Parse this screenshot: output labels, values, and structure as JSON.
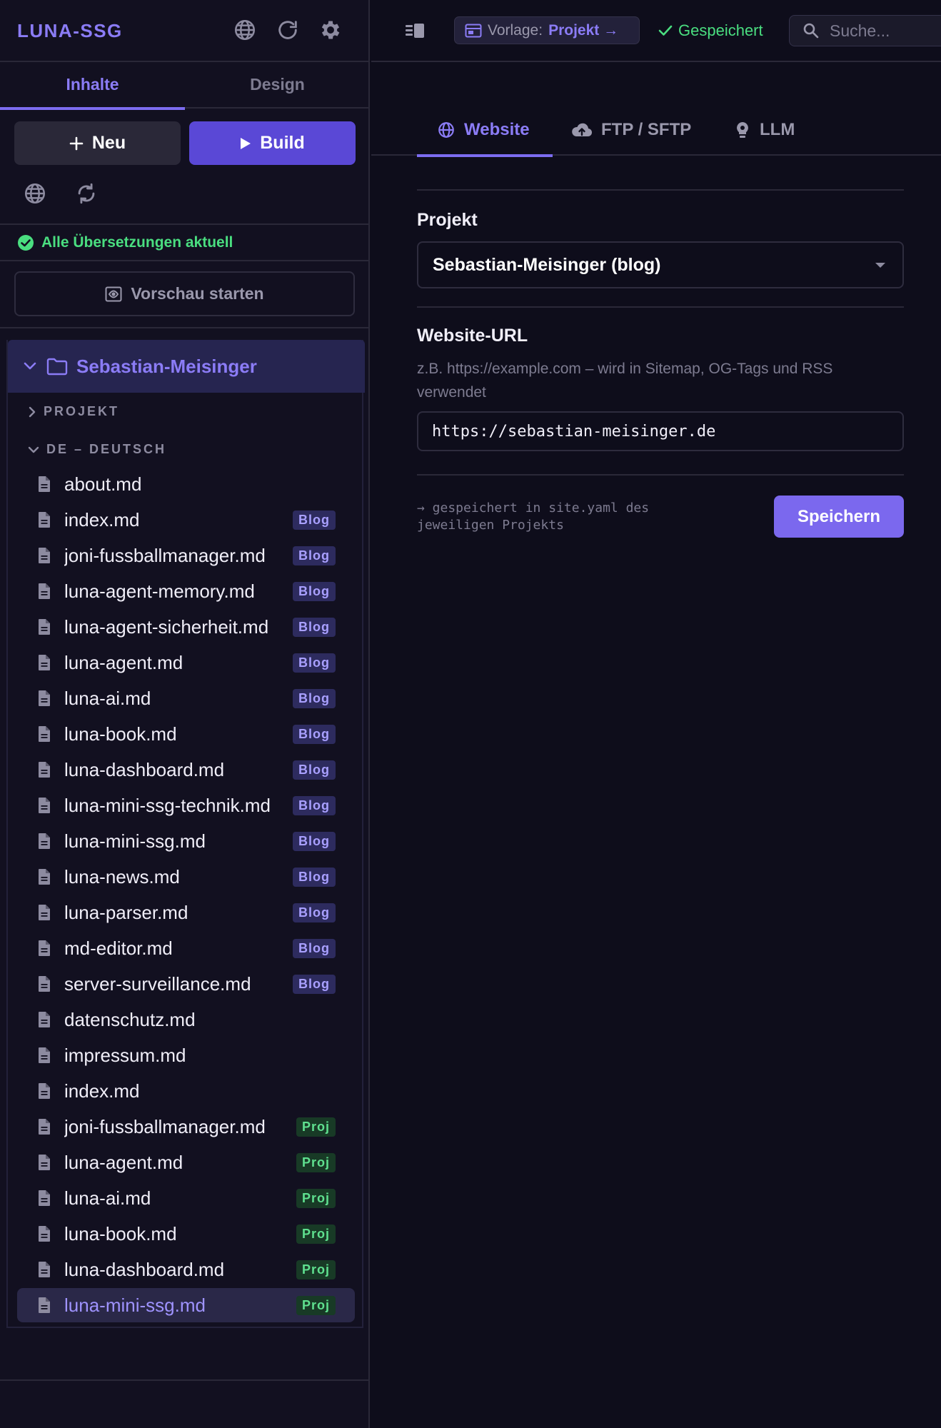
{
  "app": {
    "brand": "LUNA-SSG"
  },
  "sidebar": {
    "tabs": [
      {
        "label": "Inhalte",
        "active": true
      },
      {
        "label": "Design",
        "active": false
      }
    ],
    "new_label": "Neu",
    "build_label": "Build",
    "translation_status": "Alle Übersetzungen aktuell",
    "preview_label": "Vorschau starten",
    "tree": {
      "root": "Sebastian-Meisinger",
      "sections": [
        {
          "label": "PROJEKT",
          "expanded": false
        },
        {
          "label": "DE – DEUTSCH",
          "expanded": true
        }
      ],
      "files": [
        {
          "name": "about.md",
          "badge": ""
        },
        {
          "name": "index.md",
          "badge": "Blog"
        },
        {
          "name": "joni-fussballmanager.md",
          "badge": "Blog"
        },
        {
          "name": "luna-agent-memory.md",
          "badge": "Blog"
        },
        {
          "name": "luna-agent-sicherheit.md",
          "badge": "Blog"
        },
        {
          "name": "luna-agent.md",
          "badge": "Blog"
        },
        {
          "name": "luna-ai.md",
          "badge": "Blog"
        },
        {
          "name": "luna-book.md",
          "badge": "Blog"
        },
        {
          "name": "luna-dashboard.md",
          "badge": "Blog"
        },
        {
          "name": "luna-mini-ssg-technik.md",
          "badge": "Blog"
        },
        {
          "name": "luna-mini-ssg.md",
          "badge": "Blog"
        },
        {
          "name": "luna-news.md",
          "badge": "Blog"
        },
        {
          "name": "luna-parser.md",
          "badge": "Blog"
        },
        {
          "name": "md-editor.md",
          "badge": "Blog"
        },
        {
          "name": "server-surveillance.md",
          "badge": "Blog"
        },
        {
          "name": "datenschutz.md",
          "badge": ""
        },
        {
          "name": "impressum.md",
          "badge": ""
        },
        {
          "name": "index.md",
          "badge": ""
        },
        {
          "name": "joni-fussballmanager.md",
          "badge": "Proj"
        },
        {
          "name": "luna-agent.md",
          "badge": "Proj"
        },
        {
          "name": "luna-ai.md",
          "badge": "Proj"
        },
        {
          "name": "luna-book.md",
          "badge": "Proj"
        },
        {
          "name": "luna-dashboard.md",
          "badge": "Proj"
        },
        {
          "name": "luna-mini-ssg.md",
          "badge": "Proj",
          "selected": true
        }
      ]
    }
  },
  "topbar": {
    "template_label": "Vorlage:",
    "template_value": "Projekt →",
    "saved_label": "Gespeichert",
    "search_placeholder": "Suche..."
  },
  "main": {
    "tabs": [
      {
        "label": "Website",
        "icon": "globe-icon",
        "active": true
      },
      {
        "label": "FTP / SFTP",
        "icon": "cloud-upload-icon",
        "active": false
      },
      {
        "label": "LLM",
        "icon": "lightbulb-icon",
        "active": false
      }
    ],
    "project_label": "Projekt",
    "project_value": "Sebastian-Meisinger (blog)",
    "url_label": "Website-URL",
    "url_hint": "z.B. https://example.com – wird in Sitemap, OG-Tags und RSS verwendet",
    "url_value": "https://sebastian-meisinger.de",
    "save_note": "→ gespeichert in site.yaml des jeweiligen Projekts",
    "save_label": "Speichern"
  },
  "colors": {
    "accent": "#7c6cf0",
    "accent_text": "#8b7cf6",
    "success": "#4ade80",
    "blog_badge": "#2d2b5e",
    "proj_badge": "#183a26",
    "background": "#0e0d1b"
  }
}
